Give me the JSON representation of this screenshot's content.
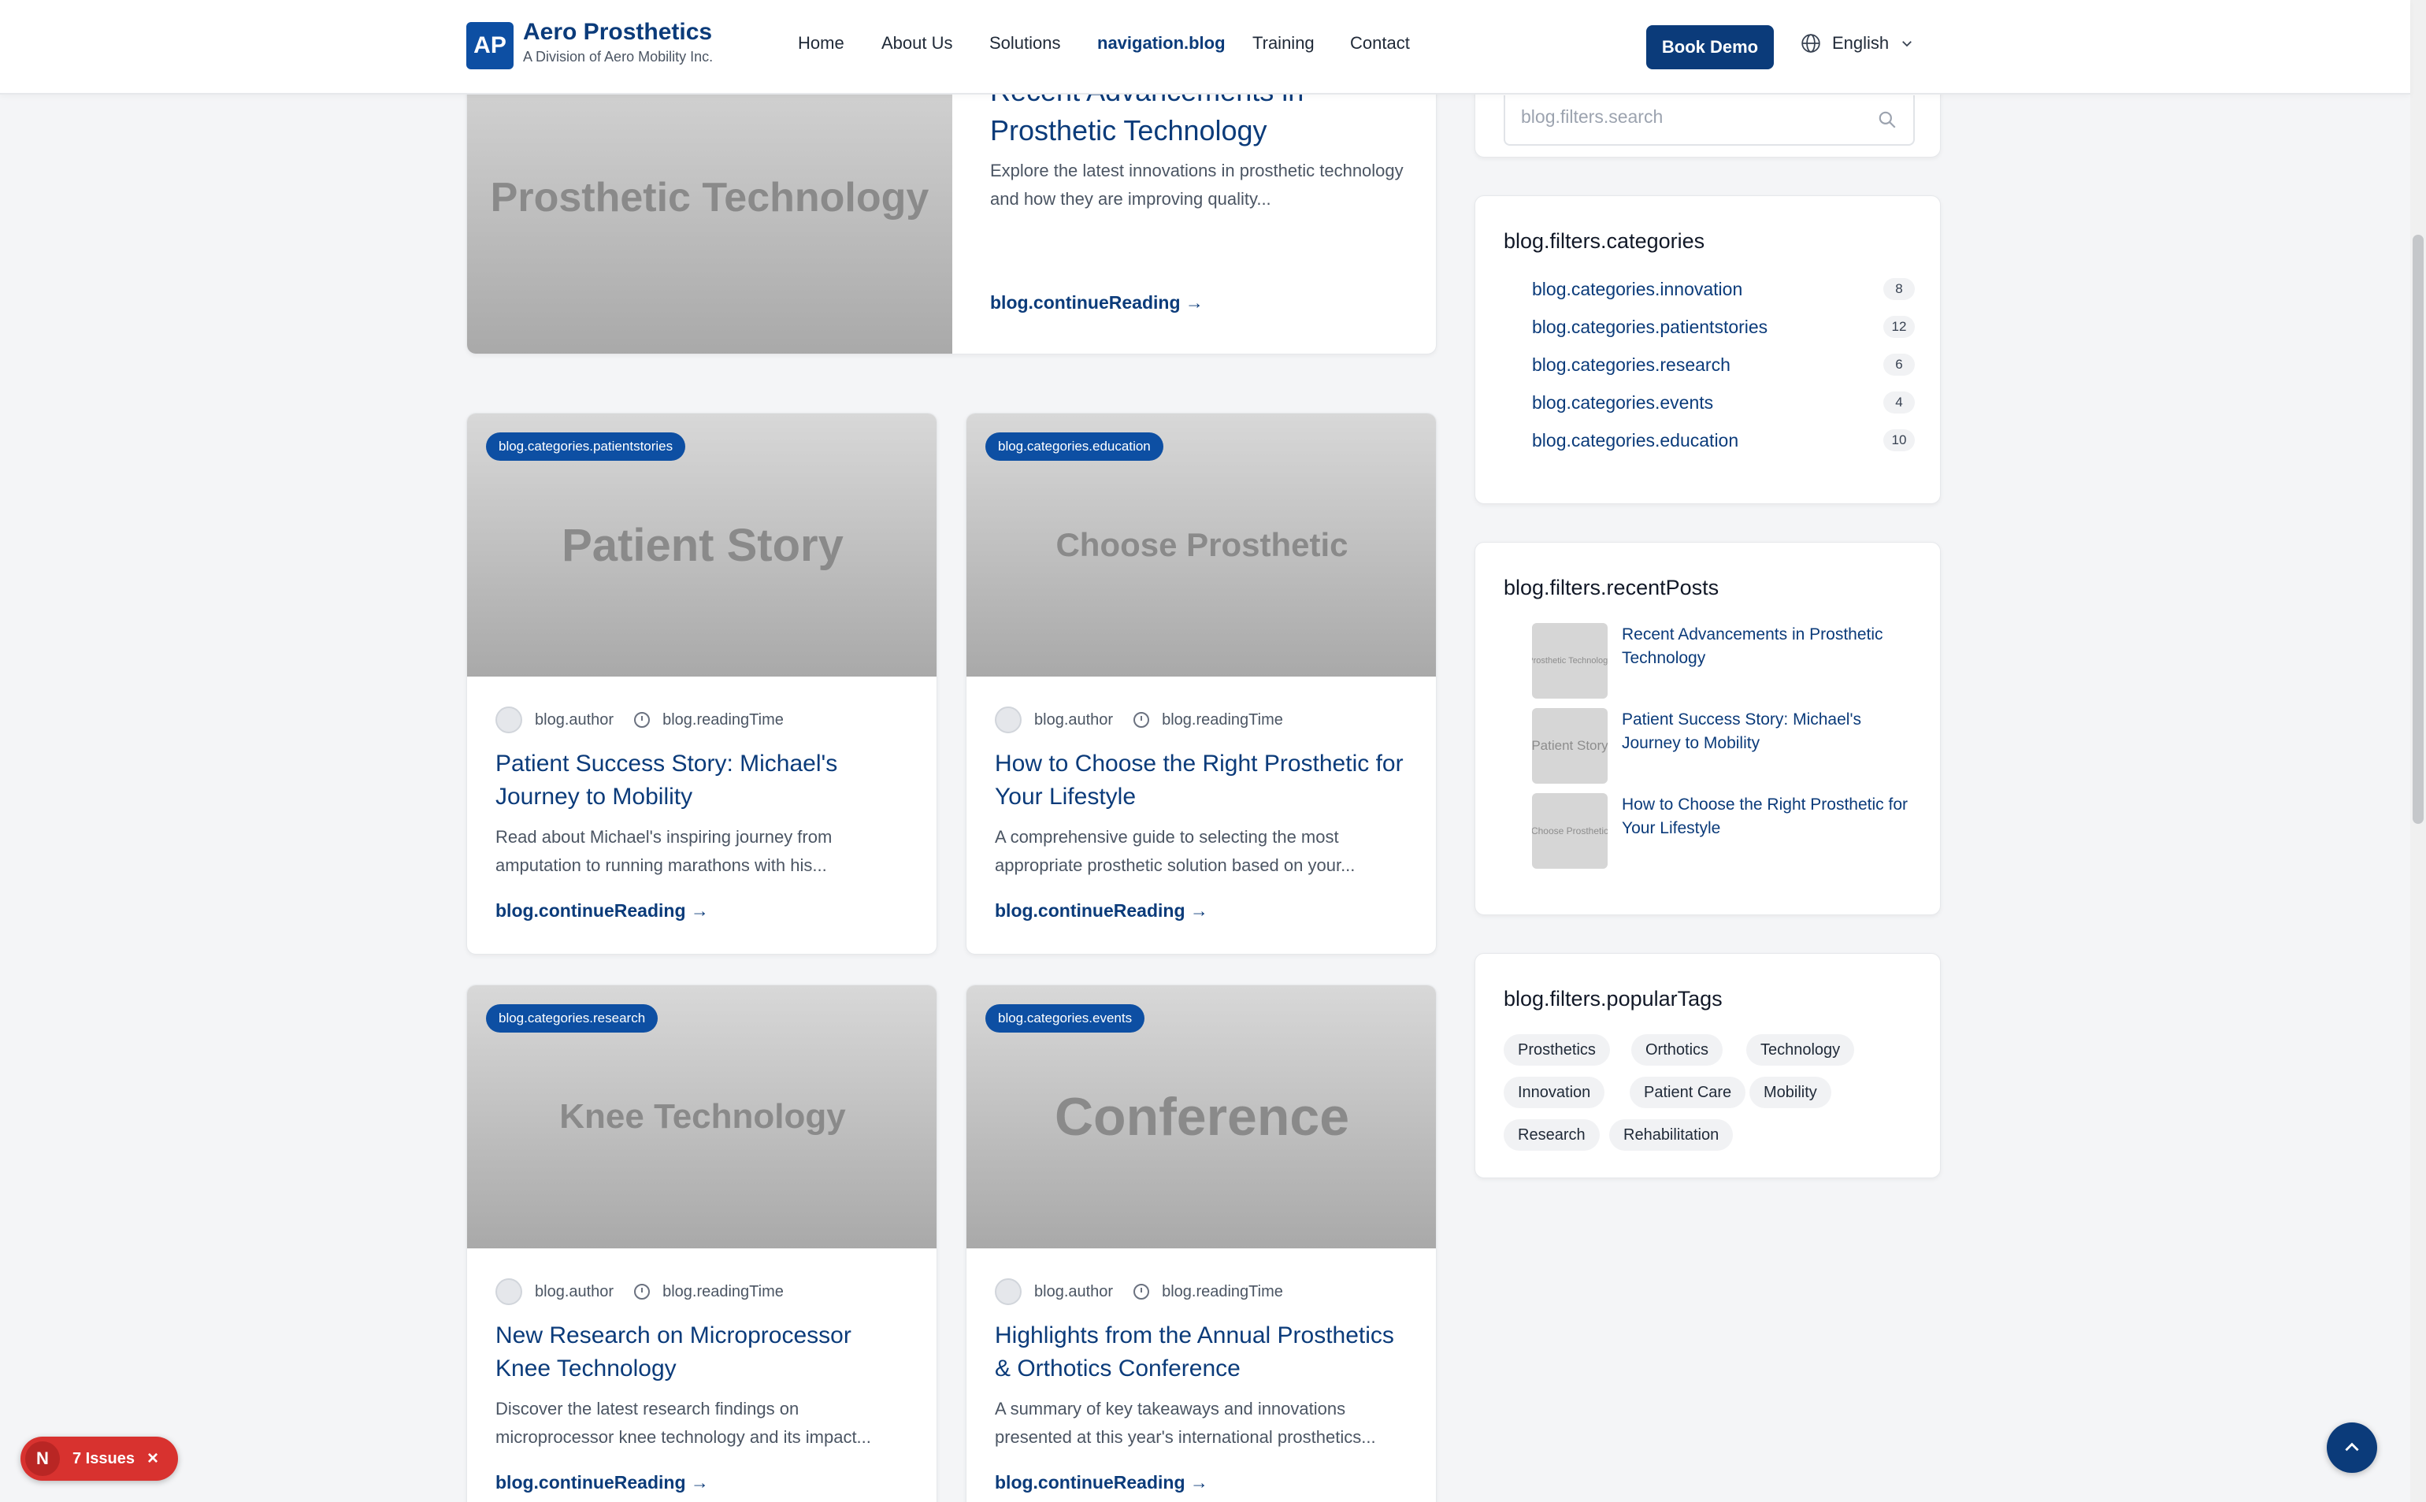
{
  "header": {
    "logo_initials": "AP",
    "brand_name": "Aero Prosthetics",
    "brand_sub": "A Division of Aero Mobility Inc.",
    "nav": [
      "Home",
      "About Us",
      "Solutions",
      "navigation.blog",
      "Training",
      "Contact"
    ],
    "active_nav": "navigation.blog",
    "cta": "Book Demo",
    "language": "English",
    "language_icon": "globe-icon"
  },
  "featured": {
    "thumb_text": "Prosthetic Technology",
    "title": "Recent Advancements in Prosthetic Technology",
    "excerpt": "Explore the latest innovations in prosthetic technology and how they are improving quality...",
    "continue": "blog.continueReading"
  },
  "posts": [
    {
      "badge": "blog.categories.patientstories",
      "thumb_text": "Patient Story",
      "author": "blog.author",
      "reading_time": "blog.readingTime",
      "title": "Patient Success Story: Michael's Journey to Mobility",
      "excerpt": "Read about Michael's inspiring journey from amputation to running marathons with his...",
      "continue": "blog.continueReading"
    },
    {
      "badge": "blog.categories.education",
      "thumb_text": "Choose Prosthetic",
      "author": "blog.author",
      "reading_time": "blog.readingTime",
      "title": "How to Choose the Right Prosthetic for Your Lifestyle",
      "excerpt": "A comprehensive guide to selecting the most appropriate prosthetic solution based on your...",
      "continue": "blog.continueReading"
    },
    {
      "badge": "blog.categories.research",
      "thumb_text": "Knee Technology",
      "author": "blog.author",
      "reading_time": "blog.readingTime",
      "title": "New Research on Microprocessor Knee Technology",
      "excerpt": "Discover the latest research findings on microprocessor knee technology and its impact...",
      "continue": "blog.continueReading"
    },
    {
      "badge": "blog.categories.events",
      "thumb_text": "Conference",
      "author": "blog.author",
      "reading_time": "blog.readingTime",
      "title": "Highlights from the Annual Prosthetics & Orthotics Conference",
      "excerpt": "A summary of key takeaways and innovations presented at this year's international prosthetics...",
      "continue": "blog.continueReading"
    }
  ],
  "sidebar": {
    "search_placeholder": "blog.filters.search",
    "categories_title": "blog.filters.categories",
    "categories": [
      {
        "label": "blog.categories.innovation",
        "count": "8"
      },
      {
        "label": "blog.categories.patientstories",
        "count": "12"
      },
      {
        "label": "blog.categories.research",
        "count": "6"
      },
      {
        "label": "blog.categories.events",
        "count": "4"
      },
      {
        "label": "blog.categories.education",
        "count": "10"
      }
    ],
    "recent_title": "blog.filters.recentPosts",
    "recent": [
      {
        "thumb_text": "Prosthetic Technology",
        "title": "Recent Advancements in Prosthetic Technology"
      },
      {
        "thumb_text": "Patient Story",
        "title": "Patient Success Story: Michael's Journey to Mobility"
      },
      {
        "thumb_text": "Choose Prosthetic",
        "title": "How to Choose the Right Prosthetic for Your Lifestyle"
      }
    ],
    "tags_title": "blog.filters.popularTags",
    "tags": [
      "Prosthetics",
      "Orthotics",
      "Technology",
      "Innovation",
      "Patient Care",
      "Mobility",
      "Research",
      "Rehabilitation"
    ]
  },
  "devtools": {
    "initial": "N",
    "issues": "7 Issues"
  },
  "colors": {
    "primary": "#0b3b7a",
    "badge": "#0d4fa3",
    "issues": "#d8322f"
  }
}
